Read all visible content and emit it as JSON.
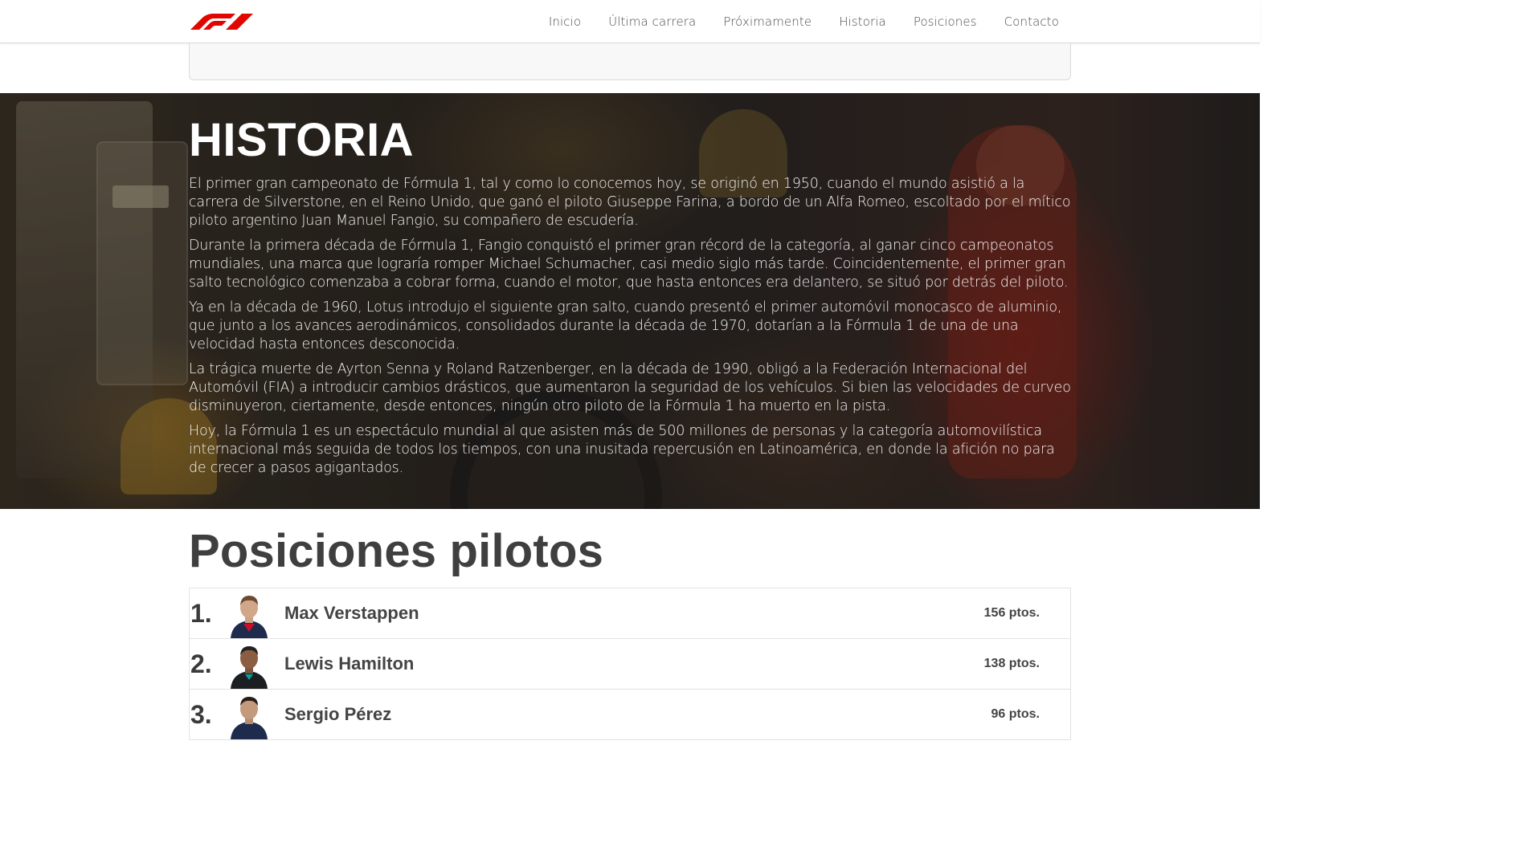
{
  "nav": {
    "logo": "F1",
    "links": [
      "Inicio",
      "Última carrera",
      "Próximamente",
      "Historia",
      "Posiciones",
      "Contacto"
    ]
  },
  "historia": {
    "title": "HISTORIA",
    "paragraphs": [
      "El primer gran campeonato de Fórmula 1, tal y como lo conocemos hoy, se originó en 1950, cuando el mundo asistió a la carrera de Silverstone, en el Reino Unido, que ganó el piloto Giuseppe Farina, a bordo de un Alfa Romeo, escoltado por el mítico piloto argentino Juan Manuel Fangio, su compañero de escudería.",
      "Durante la primera década de Fórmula 1, Fangio conquistó el primer gran récord de la categoría, al ganar cinco campeonatos mundiales, una marca que lograría romper Michael Schumacher, casi medio siglo más tarde. Coincidentemente, el primer gran salto tecnológico comenzaba a cobrar forma, cuando el motor, que hasta entonces era delantero, se situó por detrás del piloto.",
      "Ya en la década de 1960, Lotus introdujo el siguiente gran salto, cuando presentó el primer automóvil monocasco de aluminio, que junto a los avances aerodinámicos, consolidados durante la década de 1970, dotarían a la Fórmula 1 de una de una velocidad hasta entonces desconocida.",
      "La trágica muerte de Ayrton Senna y Roland Ratzenberger, en la década de 1990, obligó a la Federación Internacional del Automóvil (FIA) a introducir cambios drásticos, que aumentaron la seguridad de los vehículos. Si bien las velocidades de curveo disminuyeron, ciertamente, desde entonces, ningún otro piloto de la Fórmula 1 ha muerto en la pista.",
      "Hoy, la Fórmula 1 es un espectáculo mundial al que asisten más de 500 millones de personas y la categoría automovilística internacional más seguida de todos los tiempos, con una inusitada repercusión en Latinoamérica, en donde la afición no para de crecer a pasos agigantados."
    ]
  },
  "standings": {
    "title": "Posiciones pilotos",
    "drivers": [
      {
        "position": "1.",
        "name": "Max Verstappen",
        "points": "156 ptos.",
        "suit_color": "#1e2b4d"
      },
      {
        "position": "2.",
        "name": "Lewis Hamilton",
        "points": "138 ptos.",
        "suit_color": "#1c1f22"
      },
      {
        "position": "3.",
        "name": "Sergio Pérez",
        "points": "96 ptos.",
        "suit_color": "#1e2b4d"
      }
    ]
  },
  "colors": {
    "brand_red": "#e10600",
    "heading": "#3f3f3f",
    "nav_text": "#4a4a4a"
  }
}
